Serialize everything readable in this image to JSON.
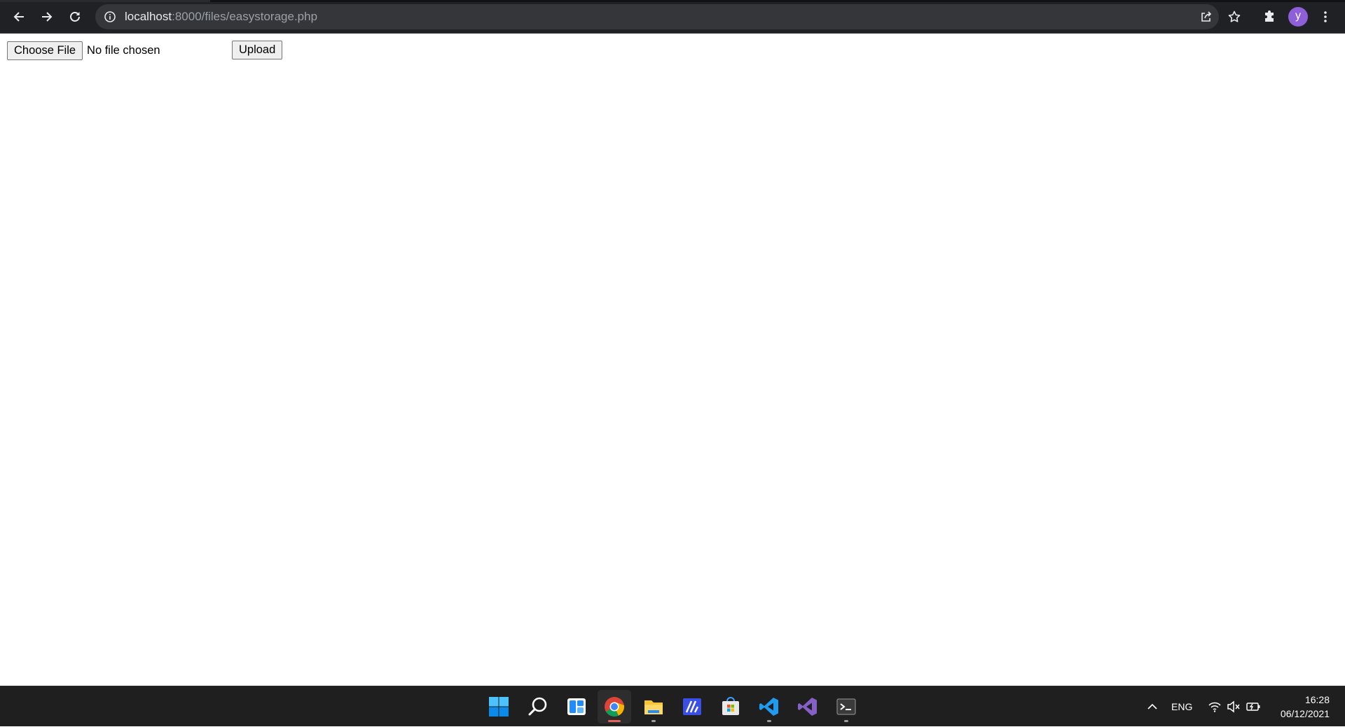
{
  "browser": {
    "url_host": "localhost",
    "url_rest": ":8000/files/easystorage.php",
    "profile_initial": "y",
    "profile_color": "#8e5fd8"
  },
  "icons": {
    "back": "back-arrow-icon",
    "forward": "forward-arrow-icon",
    "reload": "reload-icon",
    "site_info": "info-icon",
    "share": "share-icon",
    "bookmark": "star-icon",
    "extensions": "puzzle-icon",
    "menu": "more-vert-icon"
  },
  "page": {
    "choose_file_label": "Choose File",
    "no_file_text": "No file chosen",
    "upload_label": "Upload"
  },
  "taskbar": {
    "apps": [
      "Start",
      "Search",
      "Widgets",
      "Google Chrome",
      "File Explorer",
      "Azure Data Studio",
      "Microsoft Store",
      "Visual Studio Code",
      "Visual Studio",
      "Terminal"
    ],
    "language": "ENG",
    "time": "16:28",
    "date": "06/12/2021"
  }
}
